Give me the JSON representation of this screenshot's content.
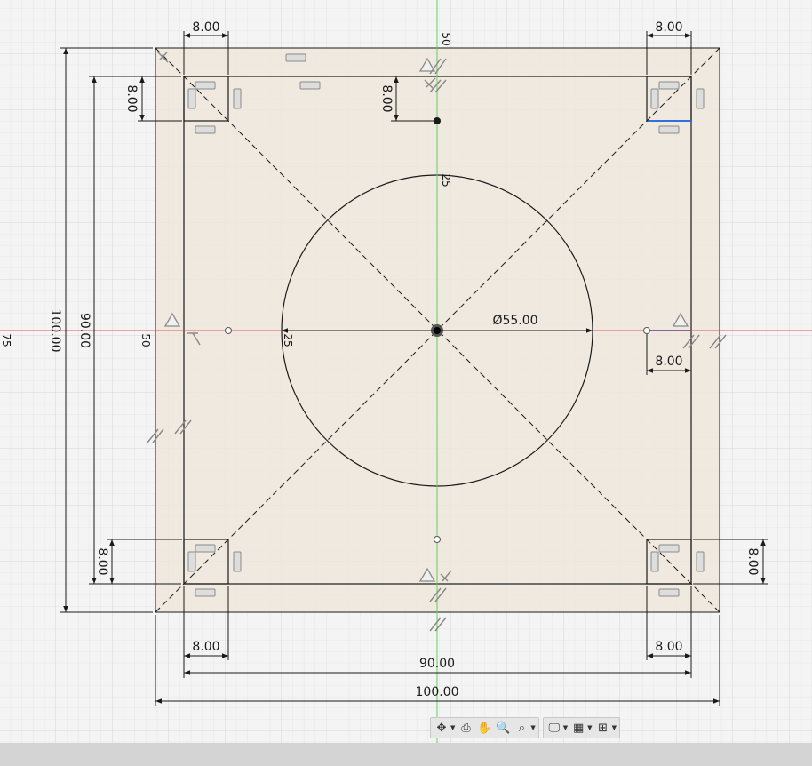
{
  "colors": {
    "background": "#f4f4f4",
    "grid_minor": "#e6e6e6",
    "grid_major": "#d6d6d6",
    "profile_fill": "#efe6db",
    "line": "#1a1a1a",
    "x_axis": "#e25555",
    "y_axis": "#5fcf5f",
    "highlight_blue": "#2f6fe0",
    "constraint_icon": "#8a8a8a"
  },
  "dimensions": {
    "width_outer": "100.00",
    "width_inner": "90.00",
    "height_outer": "100.00",
    "height_inner": "90.00",
    "circle_diameter": "Ø55.00",
    "corner_top_left_w": "8.00",
    "corner_top_right_w": "8.00",
    "corner_bottom_left_w": "8.00",
    "corner_bottom_right_w": "8.00",
    "corner_top_left_h": "8.00",
    "corner_bottom_left_h": "8.00",
    "corner_bottom_right_h": "8.00",
    "top_center_h": "8.00",
    "right_mid_w": "8.00"
  },
  "axis_labels": {
    "y_top": "50",
    "y_circle": "25",
    "x_left_50": "50",
    "x_left_75": "75",
    "x_circle": "25"
  },
  "toolbar": {
    "items": [
      {
        "name": "orbit-icon",
        "glyph": "✥",
        "has_dropdown": true
      },
      {
        "name": "look-at-icon",
        "glyph": "⎙",
        "has_dropdown": false
      },
      {
        "name": "pan-icon",
        "glyph": "✋",
        "has_dropdown": false
      },
      {
        "name": "zoom-icon",
        "glyph": "🔍",
        "has_dropdown": false
      },
      {
        "name": "fit-icon",
        "glyph": "⌕",
        "has_dropdown": true
      },
      {
        "name": "display-settings-icon",
        "glyph": "🖵",
        "has_dropdown": true
      },
      {
        "name": "grid-settings-icon",
        "glyph": "▦",
        "has_dropdown": true
      },
      {
        "name": "viewports-icon",
        "glyph": "⊞",
        "has_dropdown": true
      }
    ]
  }
}
